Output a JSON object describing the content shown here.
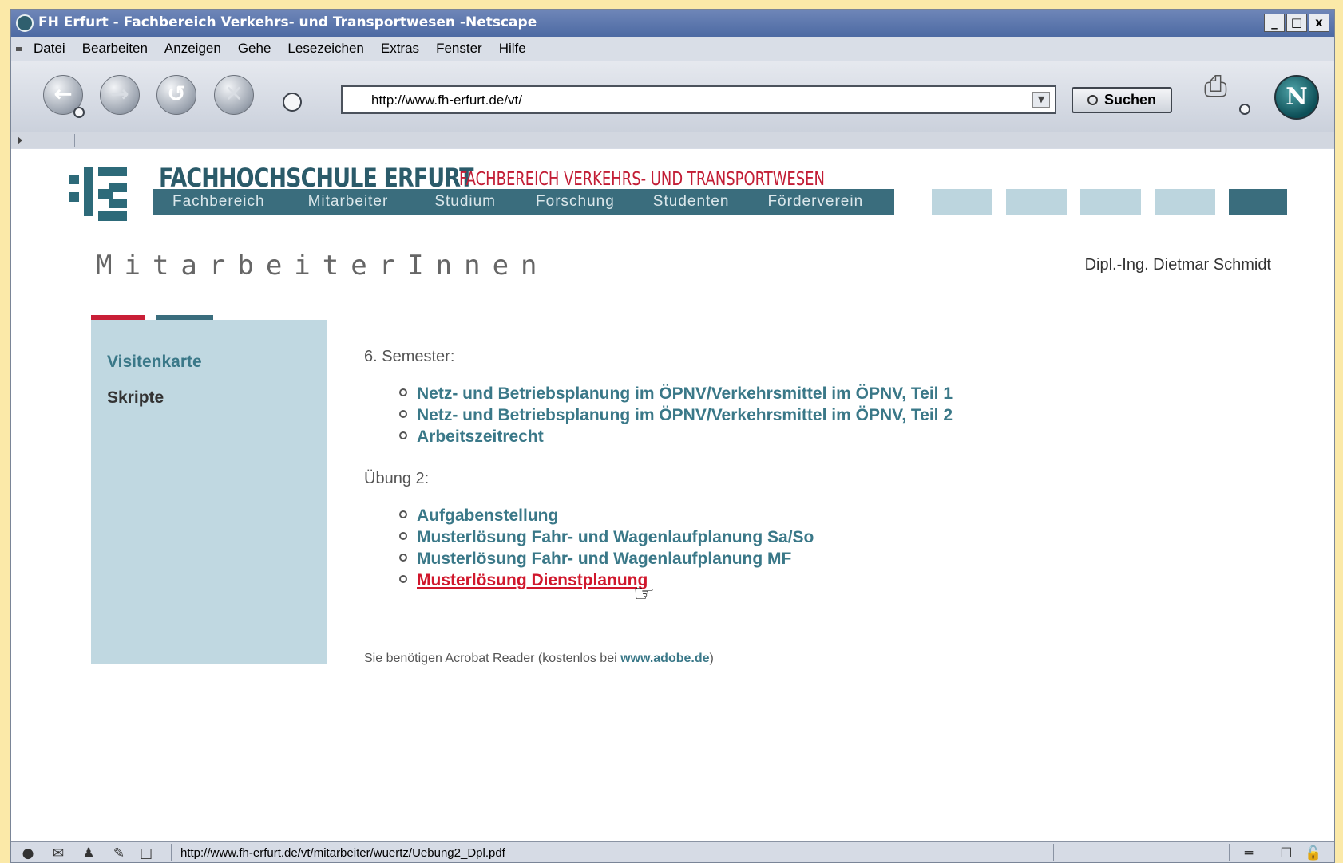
{
  "window": {
    "title": "FH Erfurt - Fachbereich Verkehrs- und Transportwesen -Netscape",
    "buttons": [
      "_",
      "□",
      "x"
    ]
  },
  "menu": [
    "Datei",
    "Bearbeiten",
    "Anzeigen",
    "Gehe",
    "Lesezeichen",
    "Extras",
    "Fenster",
    "Hilfe"
  ],
  "toolbar": {
    "url": "http://www.fh-erfurt.de/vt/",
    "search_label": "Suchen",
    "back_icon": "back-arrow-icon",
    "forward_icon": "forward-arrow-icon",
    "reload_icon": "reload-icon",
    "stop_icon": "stop-icon"
  },
  "site": {
    "brand": "FACHHOCHSCHULE ERFURT",
    "department": "FACHBEREICH VERKEHRS- UND TRANSPORTWESEN",
    "nav": [
      "Fachbereich",
      "Mitarbeiter",
      "Studium",
      "Forschung",
      "Studenten",
      "Förderverein"
    ],
    "page_title": "MitarbeiterInnen",
    "person": "Dipl.-Ing. Dietmar Schmidt",
    "sidebar": [
      "Visitenkarte",
      "Skripte"
    ],
    "semester_label": "6. Semester:",
    "semester_links": [
      "Netz- und Betriebsplanung im ÖPNV/Verkehrsmittel im ÖPNV, Teil 1",
      "Netz- und Betriebsplanung im ÖPNV/Verkehrsmittel im ÖPNV, Teil 2",
      "Arbeitszeitrecht"
    ],
    "uebung_label": "Übung 2:",
    "uebung_links": [
      "Aufgabenstellung",
      "Musterlösung Fahr- und Wagenlaufplanung Sa/So",
      "Musterlösung Fahr- und Wagenlaufplanung MF",
      "Musterlösung Dienstplanung"
    ],
    "note_prefix": "Sie benötigen Acrobat Reader (kostenlos bei ",
    "note_link": "www.adobe.de",
    "note_suffix": ")"
  },
  "status": {
    "text": "http://www.fh-erfurt.de/vt/mitarbeiter/wuertz/Uebung2_Dpl.pdf"
  },
  "colors": {
    "teal": "#3a6d7d",
    "red": "#c91f37",
    "sidebar": "#c0d8e1",
    "link": "#3a7888",
    "active_link": "#d0172c"
  }
}
